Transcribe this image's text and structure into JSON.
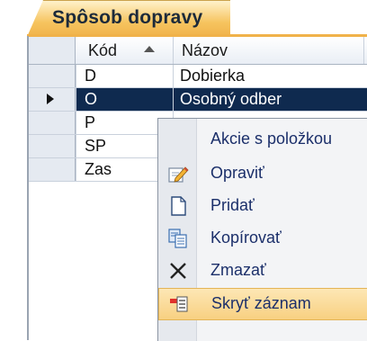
{
  "tab": {
    "title": "Spôsob dopravy"
  },
  "grid": {
    "columns": [
      {
        "label": "Kód",
        "sorted": "ascending"
      },
      {
        "label": "Názov"
      }
    ],
    "rows": [
      {
        "code": "D",
        "name": "Dobierka",
        "selected": false
      },
      {
        "code": "O",
        "name": "Osobný odber",
        "selected": true
      },
      {
        "code": "P",
        "name": "",
        "selected": false
      },
      {
        "code": "SP",
        "name": "",
        "selected": false
      },
      {
        "code": "Zas",
        "name": "",
        "selected": false
      }
    ]
  },
  "context_menu": {
    "header": "Akcie s položkou",
    "items": [
      {
        "label": "Opraviť",
        "icon": "edit-icon"
      },
      {
        "label": "Pridať",
        "icon": "new-document-icon"
      },
      {
        "label": "Kopírovať",
        "icon": "copy-icon"
      },
      {
        "label": "Zmazať",
        "icon": "delete-icon"
      },
      {
        "label": "Skryť záznam",
        "icon": "hide-record-icon"
      }
    ]
  },
  "colors": {
    "tab_accent": "#f0b24a",
    "selection": "#0f2a4f",
    "menu_text": "#1b2f6a",
    "menu_hover": "#f8d081"
  }
}
